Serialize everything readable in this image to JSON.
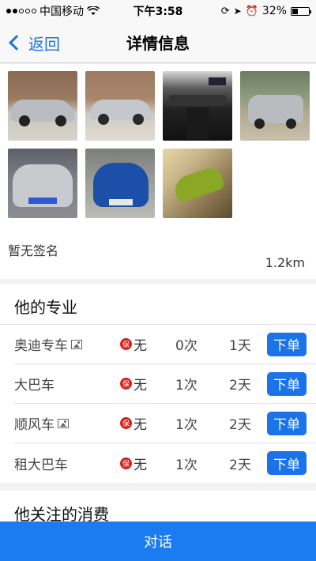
{
  "status_bar": {
    "carrier": "中国移动",
    "time": "下午3:58",
    "battery": "32%"
  },
  "nav": {
    "back_label": "返回",
    "title": "详情信息"
  },
  "profile": {
    "signature": "暂无签名",
    "distance": "1.2km"
  },
  "specialty": {
    "title": "他的专业",
    "order_label": "下单",
    "rows": [
      {
        "name": "奥迪专车",
        "has_image": true,
        "insurance": "无",
        "times": "0次",
        "days": "1天"
      },
      {
        "name": "大巴车",
        "has_image": false,
        "insurance": "无",
        "times": "1次",
        "days": "2天"
      },
      {
        "name": "顺风车",
        "has_image": true,
        "insurance": "无",
        "times": "1次",
        "days": "2天"
      },
      {
        "name": "租大巴车",
        "has_image": false,
        "insurance": "无",
        "times": "1次",
        "days": "2天"
      }
    ],
    "insurance_badge": "保"
  },
  "followed": {
    "title": "他关注的消费"
  },
  "chat_button": "对话",
  "colors": {
    "accent": "#1a73e8",
    "badge_red": "#d9201b",
    "chat_blue": "#1a7cf0"
  }
}
